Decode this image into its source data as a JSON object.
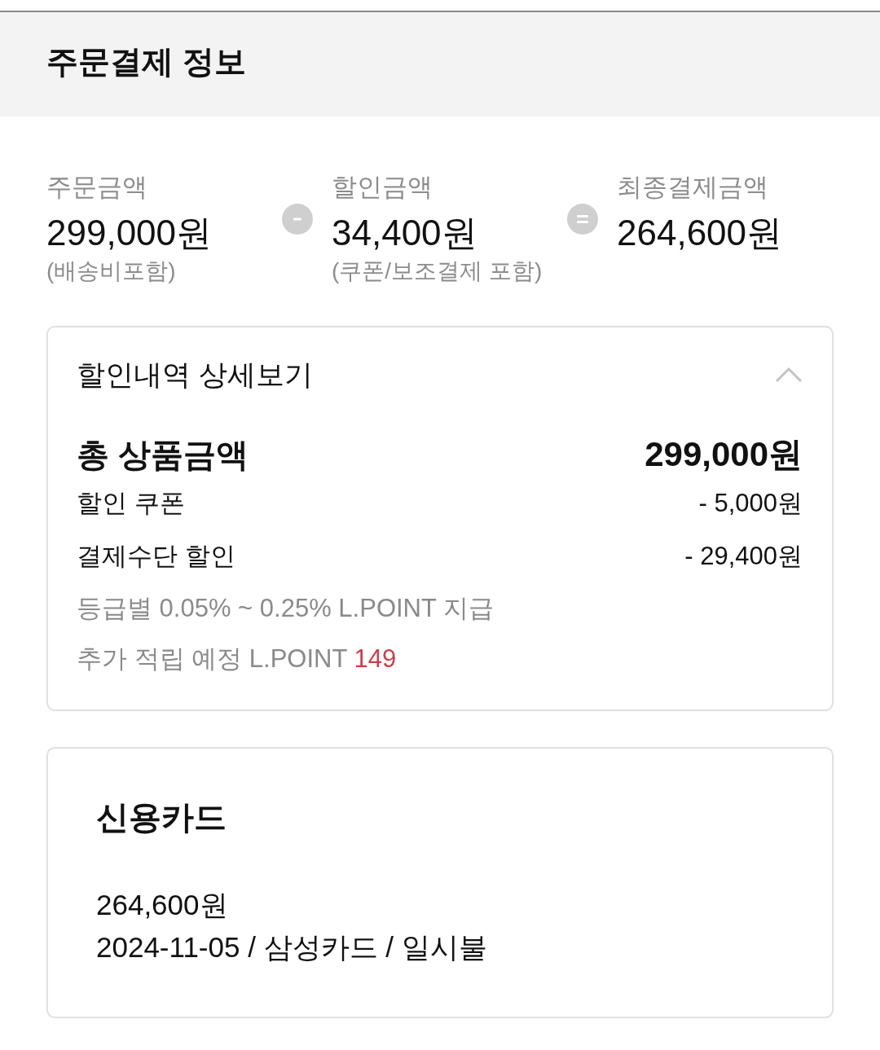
{
  "header": {
    "title": "주문결제 정보"
  },
  "summary": {
    "items": [
      {
        "label": "주문금액",
        "amount": "299,000원",
        "note": "(배송비포함)"
      },
      {
        "label": "할인금액",
        "amount": "34,400원",
        "note": "(쿠폰/보조결제 포함)"
      },
      {
        "label": "최종결제금액",
        "amount": "264,600원"
      }
    ]
  },
  "discount_detail": {
    "title": "할인내역 상세보기",
    "expanded": true,
    "total": {
      "label": "총 상품금액",
      "amount": "299,000원"
    },
    "lines": [
      {
        "label": "할인 쿠폰",
        "amount": "- 5,000원"
      },
      {
        "label": "결제수단 할인",
        "amount": "- 29,400원"
      }
    ],
    "notes": [
      {
        "text": "등급별 0.05% ~ 0.25% L.POINT 지급"
      },
      {
        "text": "추가 적립 예정 L.POINT",
        "highlight": "149"
      }
    ]
  },
  "payment": {
    "method": "신용카드",
    "amount": "264,600원",
    "detail": "2024-11-05 / 삼성카드 / 일시불"
  }
}
